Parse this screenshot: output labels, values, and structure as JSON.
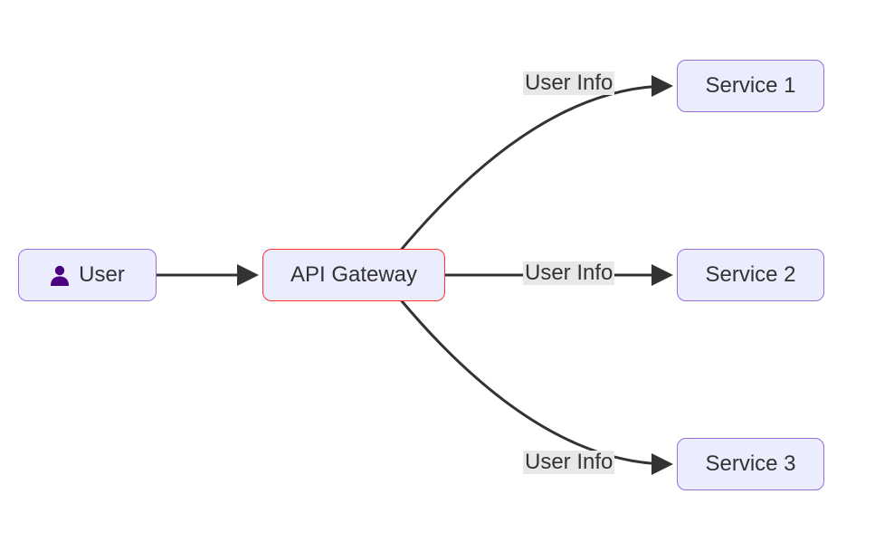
{
  "nodes": {
    "user": {
      "label": "User"
    },
    "gateway": {
      "label": "API Gateway"
    },
    "s1": {
      "label": "Service 1"
    },
    "s2": {
      "label": "Service 2"
    },
    "s3": {
      "label": "Service 3"
    }
  },
  "edges": {
    "user_to_gateway": {
      "label": ""
    },
    "gateway_to_s1": {
      "label": "User Info"
    },
    "gateway_to_s2": {
      "label": "User Info"
    },
    "gateway_to_s3": {
      "label": "User Info"
    }
  },
  "colors": {
    "node_fill": "#ECECFF",
    "node_border": "#9370DB",
    "gateway_border": "#ff3333",
    "edge": "#333333",
    "edge_label_bg": "#e8e8e8",
    "user_icon": "#4B0082"
  }
}
